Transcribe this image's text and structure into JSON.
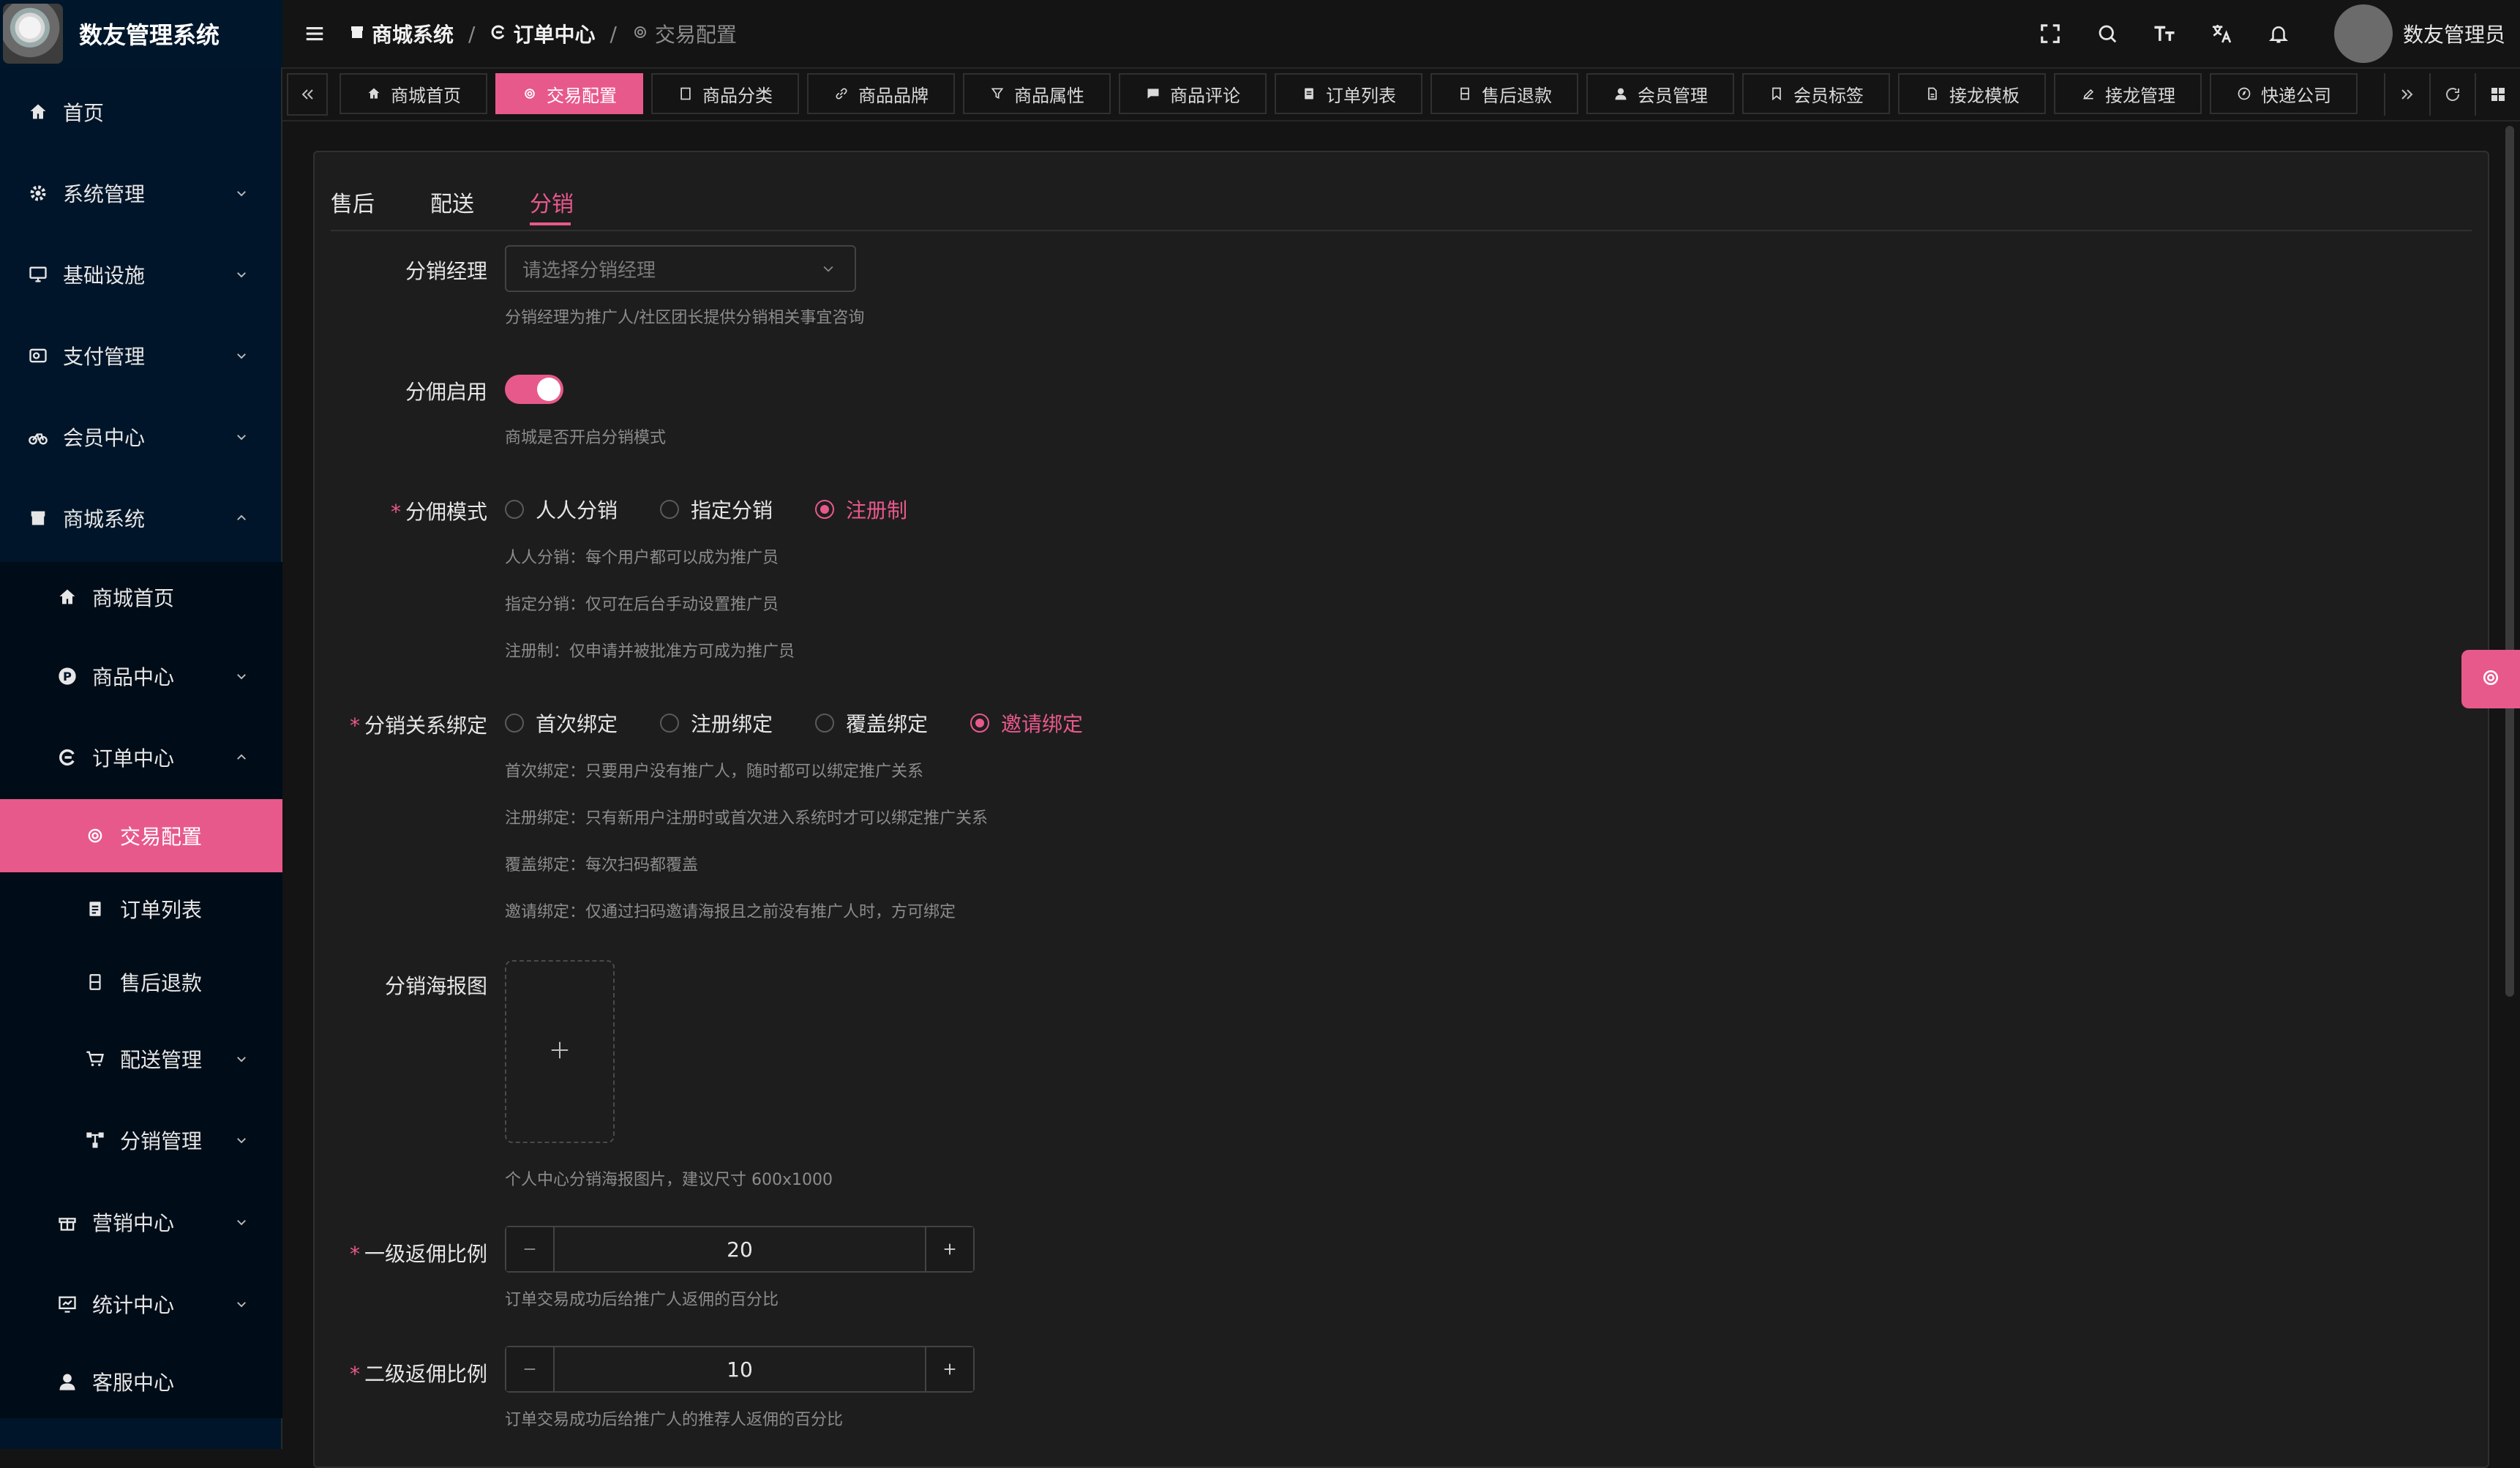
{
  "app": {
    "title": "数友管理系统"
  },
  "sidebar": {
    "items": [
      {
        "label": "首页",
        "icon": "home-icon"
      },
      {
        "label": "系统管理",
        "icon": "gear-icon"
      },
      {
        "label": "基础设施",
        "icon": "monitor-icon"
      },
      {
        "label": "支付管理",
        "icon": "payment-icon"
      },
      {
        "label": "会员中心",
        "icon": "bike-icon"
      },
      {
        "label": "商城系统",
        "icon": "shop-icon"
      }
    ],
    "mall_sub": [
      {
        "label": "商城首页",
        "icon": "home-icon"
      },
      {
        "label": "商品中心",
        "icon": "product-icon"
      },
      {
        "label": "订单中心",
        "icon": "order-icon"
      }
    ],
    "order_sub": [
      {
        "label": "交易配置",
        "icon": "gear-icon"
      },
      {
        "label": "订单列表",
        "icon": "list-icon"
      },
      {
        "label": "售后退款",
        "icon": "refund-icon"
      },
      {
        "label": "配送管理",
        "icon": "cart-icon"
      },
      {
        "label": "分销管理",
        "icon": "network-icon"
      }
    ],
    "tail": [
      {
        "label": "营销中心",
        "icon": "gift-icon"
      },
      {
        "label": "统计中心",
        "icon": "chart-icon"
      },
      {
        "label": "客服中心",
        "icon": "user-icon"
      }
    ]
  },
  "header": {
    "breadcrumbs": [
      "商城系统",
      "订单中心",
      "交易配置"
    ],
    "username": "数友管理员"
  },
  "tabs": [
    {
      "label": "商城首页",
      "active": false
    },
    {
      "label": "交易配置",
      "active": true
    },
    {
      "label": "商品分类",
      "active": false
    },
    {
      "label": "商品品牌",
      "active": false
    },
    {
      "label": "商品属性",
      "active": false
    },
    {
      "label": "商品评论",
      "active": false
    },
    {
      "label": "订单列表",
      "active": false
    },
    {
      "label": "售后退款",
      "active": false
    },
    {
      "label": "会员管理",
      "active": false
    },
    {
      "label": "会员标签",
      "active": false
    },
    {
      "label": "接龙模板",
      "active": false
    },
    {
      "label": "接龙管理",
      "active": false
    },
    {
      "label": "快递公司",
      "active": false
    }
  ],
  "inner_tabs": [
    "售后",
    "配送",
    "分销"
  ],
  "form": {
    "manager": {
      "label": "分销经理",
      "placeholder": "请选择分销经理",
      "desc": "分销经理为推广人/社区团长提供分销相关事宜咨询"
    },
    "enable": {
      "label": "分佣启用",
      "on": true,
      "desc": "商城是否开启分销模式"
    },
    "mode": {
      "label": "分佣模式",
      "options": [
        "人人分销",
        "指定分销",
        "注册制"
      ],
      "selected": "注册制",
      "descs": [
        "人人分销：每个用户都可以成为推广员",
        "指定分销：仅可在后台手动设置推广员",
        "注册制：仅申请并被批准方可成为推广员"
      ]
    },
    "binding": {
      "label": "分销关系绑定",
      "options": [
        "首次绑定",
        "注册绑定",
        "覆盖绑定",
        "邀请绑定"
      ],
      "selected": "邀请绑定",
      "descs": [
        "首次绑定：只要用户没有推广人，随时都可以绑定推广关系",
        "注册绑定：只有新用户注册时或首次进入系统时才可以绑定推广关系",
        "覆盖绑定：每次扫码都覆盖",
        "邀请绑定：仅通过扫码邀请海报且之前没有推广人时，方可绑定"
      ]
    },
    "poster": {
      "label": "分销海报图",
      "desc": "个人中心分销海报图片，建议尺寸 600x1000"
    },
    "level1": {
      "label": "一级返佣比例",
      "value": "20",
      "desc": "订单交易成功后给推广人返佣的百分比"
    },
    "level2": {
      "label": "二级返佣比例",
      "value": "10",
      "desc": "订单交易成功后给推广人的推荐人返佣的百分比"
    }
  },
  "colors": {
    "accent": "#e8598b",
    "sidebar": "#001529"
  }
}
